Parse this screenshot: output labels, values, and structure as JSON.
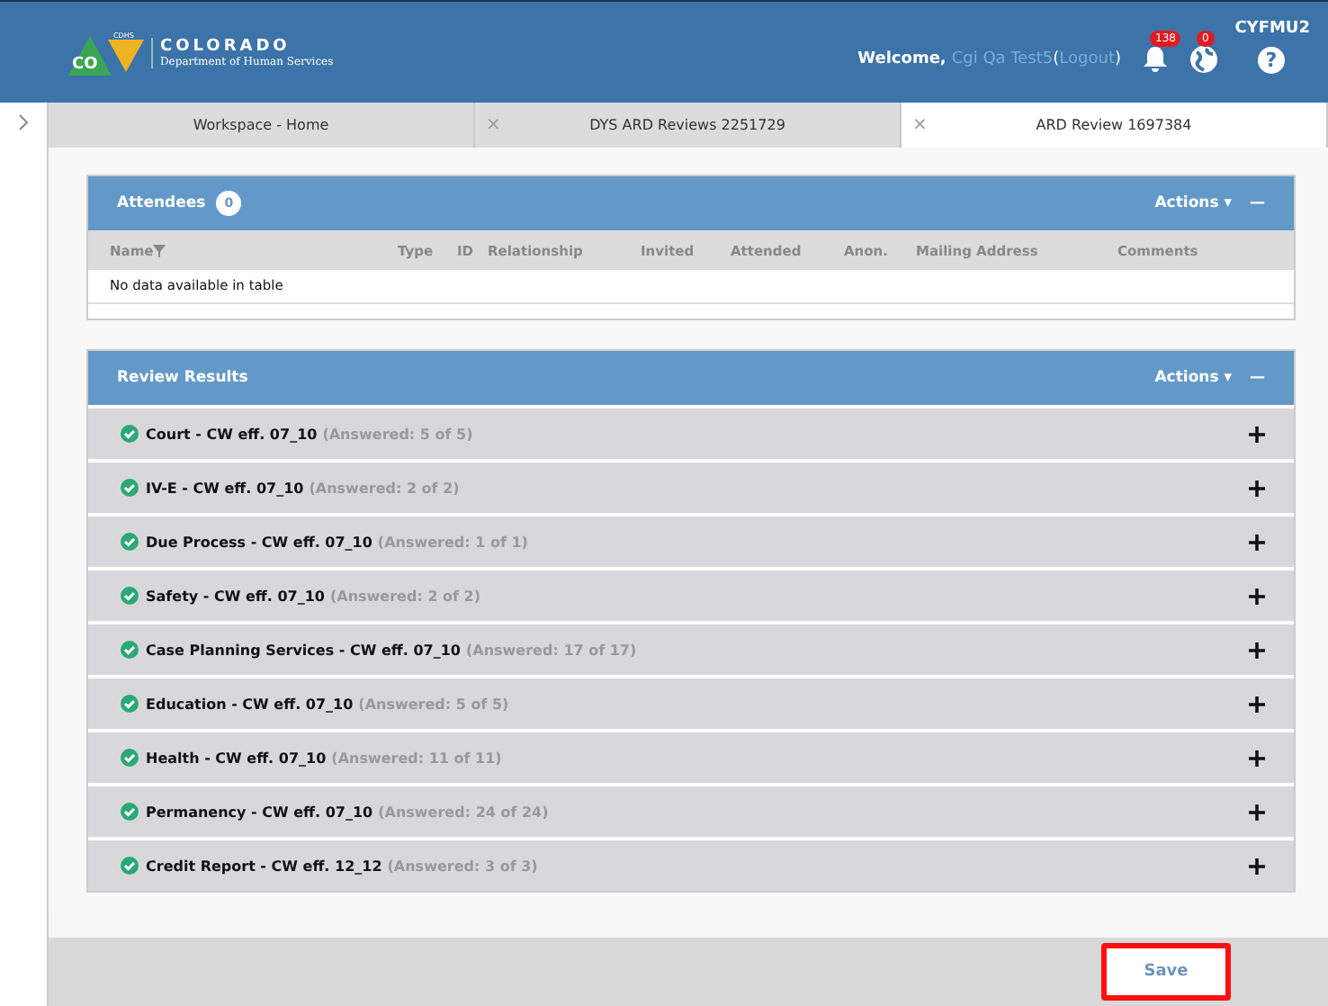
{
  "header": {
    "logo_text": "CO",
    "logo_badge": "CDHS",
    "org_name": "COLORADO",
    "org_sub": "Department of Human Services",
    "welcome": "Welcome,",
    "user": "Cgi Qa Test5",
    "logout_open": "(",
    "logout": "Logout",
    "logout_close": ")",
    "notifications": "138",
    "globe_count": "0",
    "help": "?",
    "unit": "CYFMU2"
  },
  "tabs": [
    {
      "label": "Workspace - Home",
      "selected": false
    },
    {
      "label": "DYS ARD Reviews 2251729",
      "selected": false,
      "close": "×"
    },
    {
      "label": "ARD Review 1697384",
      "selected": true,
      "close": "×"
    }
  ],
  "attendees": {
    "title": "Attendees",
    "count": "0",
    "actions": "Actions ▾",
    "collapse": "—",
    "columns": [
      "Name",
      "Type",
      "ID",
      "Relationship",
      "Invited",
      "Attended",
      "Anon.",
      "Mailing Address",
      "Comments"
    ],
    "empty": "No data available in table"
  },
  "review_results": {
    "title": "Review Results",
    "actions": "Actions ▾",
    "collapse": "—",
    "items": [
      {
        "name": "Court - CW eff. 07_10",
        "answered": "(Answered: 5 of 5)",
        "complete": true
      },
      {
        "name": "IV-E - CW eff. 07_10",
        "answered": "(Answered: 2 of 2)",
        "complete": true
      },
      {
        "name": "Due Process - CW eff. 07_10",
        "answered": "(Answered: 1 of 1)",
        "complete": true
      },
      {
        "name": "Safety - CW eff. 07_10",
        "answered": "(Answered: 2 of 2)",
        "complete": true
      },
      {
        "name": "Case Planning Services - CW eff. 07_10",
        "answered": "(Answered: 17 of 17)",
        "complete": true
      },
      {
        "name": "Education - CW eff. 07_10",
        "answered": "(Answered: 5 of 5)",
        "complete": true
      },
      {
        "name": "Health - CW eff. 07_10",
        "answered": "(Answered: 11 of 11)",
        "complete": true
      },
      {
        "name": "Permanency - CW eff. 07_10",
        "answered": "(Answered: 24 of 24)",
        "complete": true
      },
      {
        "name": "Credit Report - CW eff. 12_12",
        "answered": "(Answered: 3 of 3)",
        "complete": true
      }
    ]
  },
  "save_button": "Save"
}
